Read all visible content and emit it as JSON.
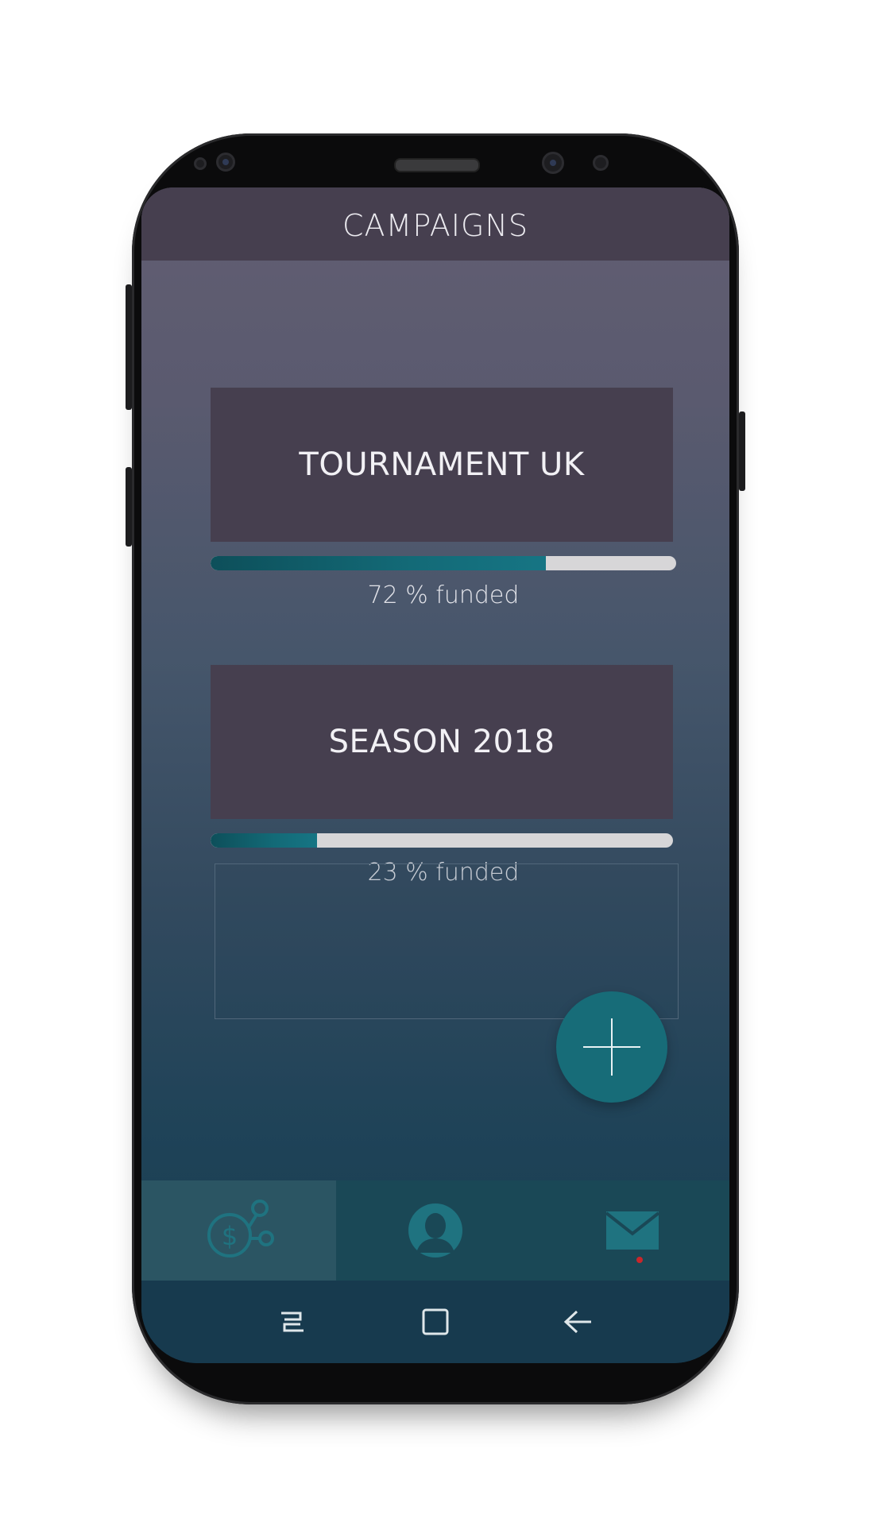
{
  "app": {
    "title": "CAMPAIGNS"
  },
  "campaigns": [
    {
      "name": "TOURNAMENT UK",
      "progress": 0.72,
      "progress_label": "72 % funded"
    },
    {
      "name": "SEASON 2018",
      "progress": 0.23,
      "progress_label": "23 % funded"
    }
  ],
  "fab": {
    "icon": "plus-icon"
  },
  "bottom_nav": {
    "items": [
      {
        "icon": "dollar-network-icon",
        "active": true
      },
      {
        "icon": "profile-icon",
        "active": false
      },
      {
        "icon": "mail-icon",
        "active": false,
        "notification": true
      }
    ]
  },
  "system_nav": {
    "items": [
      {
        "icon": "recents-icon"
      },
      {
        "icon": "home-icon"
      },
      {
        "icon": "back-icon"
      }
    ]
  },
  "colors": {
    "header": "#463f4f",
    "card": "#463f4f",
    "accent": "#176c78",
    "progress_track": "#d7d6d8",
    "nav_bar": "#1a4856",
    "notification_dot": "#c9262b"
  }
}
